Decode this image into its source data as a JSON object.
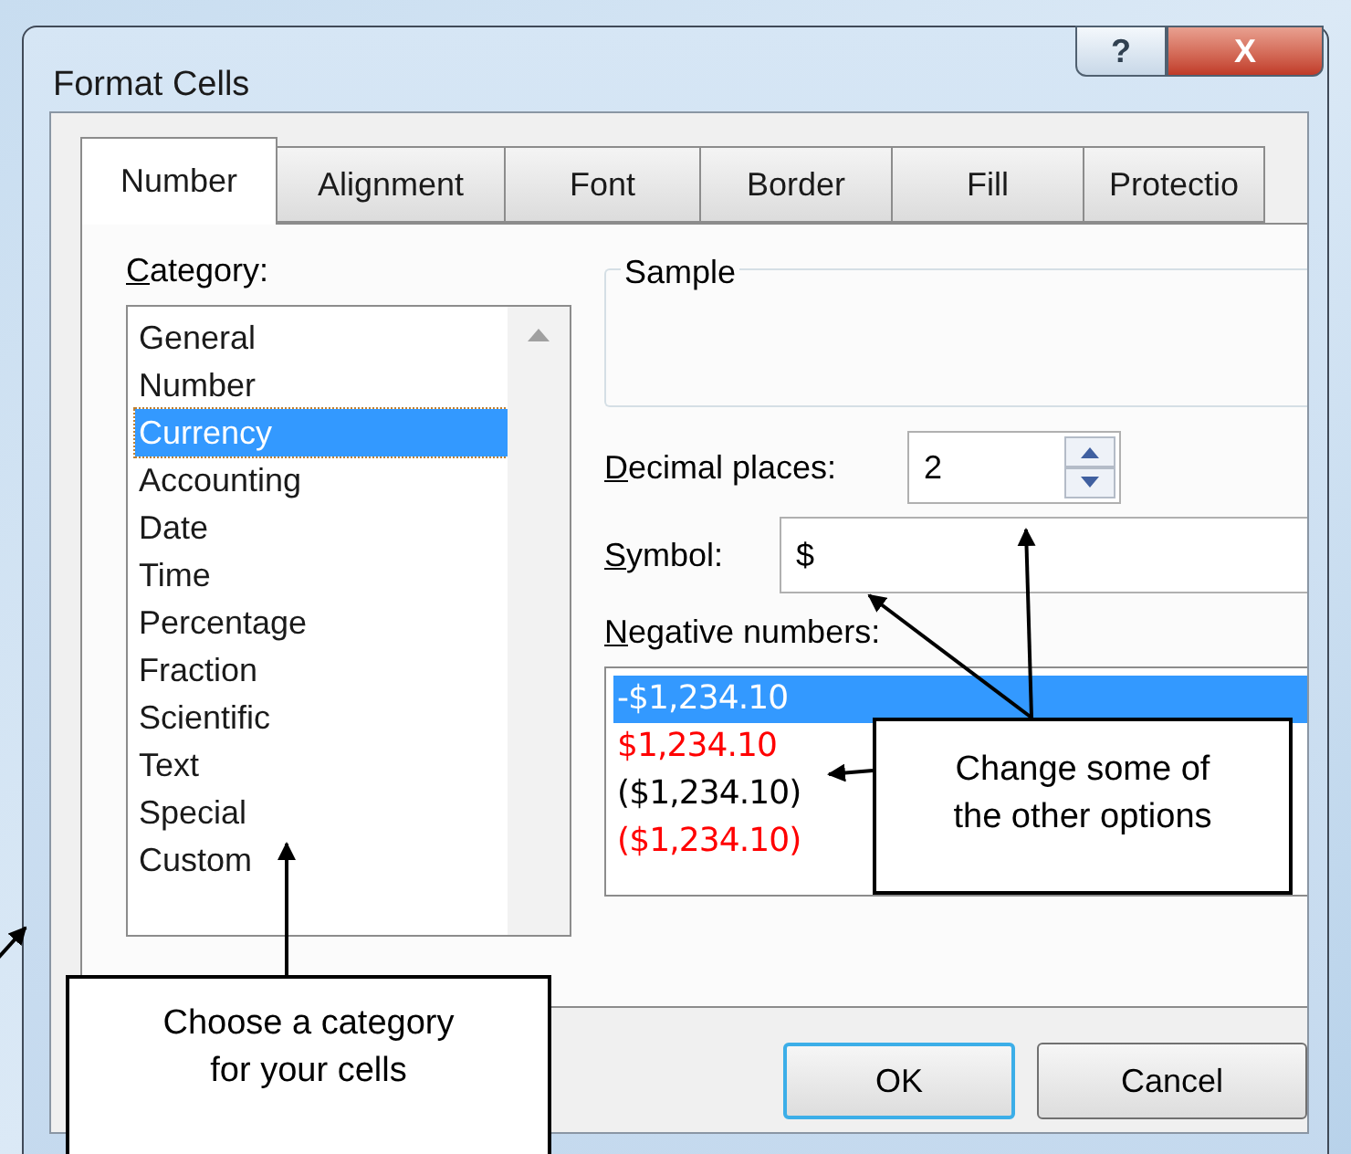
{
  "window": {
    "title": "Format Cells",
    "buttons": [
      {
        "kind": "help",
        "label": "?"
      },
      {
        "kind": "close",
        "label": "X"
      }
    ]
  },
  "tabs": [
    {
      "label": "Number",
      "selected": true
    },
    {
      "label": "Alignment",
      "selected": false
    },
    {
      "label": "Font",
      "selected": false
    },
    {
      "label": "Border",
      "selected": false
    },
    {
      "label": "Fill",
      "selected": false
    },
    {
      "label": "Protectio",
      "selected": false
    }
  ],
  "category": {
    "label": "Category:",
    "items": [
      {
        "label": "General",
        "selected": false
      },
      {
        "label": "Number",
        "selected": false
      },
      {
        "label": "Currency",
        "selected": true
      },
      {
        "label": "Accounting",
        "selected": false
      },
      {
        "label": "Date",
        "selected": false
      },
      {
        "label": "Time",
        "selected": false
      },
      {
        "label": "Percentage",
        "selected": false
      },
      {
        "label": "Fraction",
        "selected": false
      },
      {
        "label": "Scientific",
        "selected": false
      },
      {
        "label": "Text",
        "selected": false
      },
      {
        "label": "Special",
        "selected": false
      },
      {
        "label": "Custom",
        "selected": false
      }
    ]
  },
  "sample": {
    "label": "Sample"
  },
  "decimal_places": {
    "label": "Decimal places:",
    "value": "2"
  },
  "symbol": {
    "label": "Symbol:",
    "value": "$"
  },
  "negative_numbers": {
    "label": "Negative numbers:",
    "items": [
      {
        "label": "-$1,234.10",
        "selected": true
      },
      {
        "label": "$1,234.10",
        "color": "#ff0000",
        "selected": false
      },
      {
        "label": "($1,234.10)",
        "color": "#000000",
        "selected": false
      },
      {
        "label": "($1,234.10)",
        "color": "#ff0000",
        "selected": false
      }
    ]
  },
  "buttons": [
    {
      "label": "OK",
      "default": true
    },
    {
      "label": "Cancel",
      "default": false
    }
  ],
  "callouts": [
    {
      "text": "Change some of the other options"
    },
    {
      "text": "Choose a category for your cells"
    }
  ]
}
